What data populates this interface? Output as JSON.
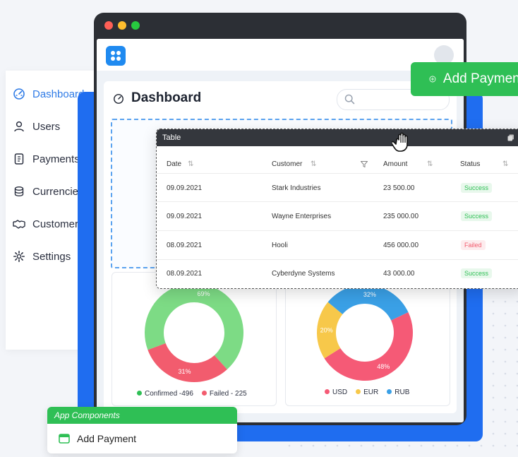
{
  "sidebar": {
    "items": [
      {
        "label": "Dashboard",
        "icon": "gauge-icon",
        "active": true
      },
      {
        "label": "Users",
        "icon": "user-icon"
      },
      {
        "label": "Payments",
        "icon": "document-icon"
      },
      {
        "label": "Currencies",
        "icon": "coins-icon"
      },
      {
        "label": "Customers",
        "icon": "handshake-icon"
      },
      {
        "label": "Settings",
        "icon": "gear-icon"
      }
    ]
  },
  "header": {
    "title": "Dashboard"
  },
  "search": {
    "placeholder": ""
  },
  "actions": {
    "add_payment": "Add Payment"
  },
  "table": {
    "title": "Table",
    "columns": [
      "Date",
      "Customer",
      "Amount",
      "Status"
    ],
    "rows": [
      {
        "date": "09.09.2021",
        "customer": "Stark Industries",
        "amount": "23 500.00",
        "status": "Success"
      },
      {
        "date": "09.09.2021",
        "customer": "Wayne Enterprises",
        "amount": "235 000.00",
        "status": "Success"
      },
      {
        "date": "08.09.2021",
        "customer": "Hooli",
        "amount": "456 000.00",
        "status": "Failed"
      },
      {
        "date": "08.09.2021",
        "customer": "Cyberdyne Systems",
        "amount": "43 000.00",
        "status": "Success"
      }
    ]
  },
  "charts": {
    "status": {
      "slices": [
        {
          "label": "69%",
          "value": 69
        },
        {
          "label": "31%",
          "value": 31
        }
      ],
      "legend": [
        "Confirmed -496",
        "Failed - 225"
      ]
    },
    "currency": {
      "slices": [
        {
          "label": "48%",
          "value": 48
        },
        {
          "label": "20%",
          "value": 20
        },
        {
          "label": "32%",
          "value": 32
        }
      ],
      "legend": [
        "USD",
        "EUR",
        "RUB"
      ]
    }
  },
  "components": {
    "title": "App Components",
    "item": "Add Payment"
  },
  "colors": {
    "accent": "#2f7be6",
    "green": "#2fbf55",
    "confirmed": "#7ddb85",
    "failed": "#f25c6e",
    "usd": "#f55a76",
    "eur": "#f7c84a",
    "rub": "#3aa0e6"
  }
}
